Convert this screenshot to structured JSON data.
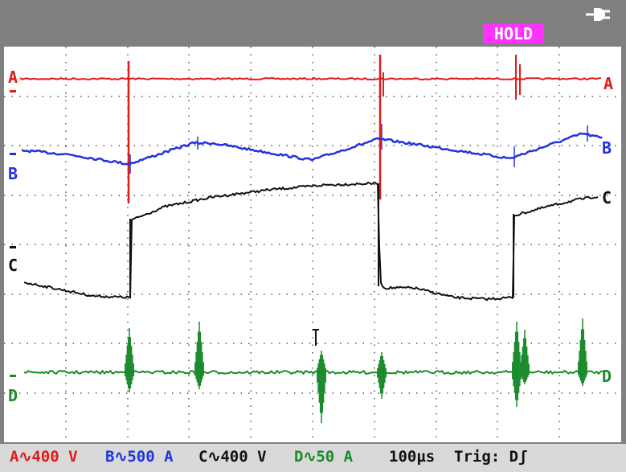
{
  "status": {
    "hold": "HOLD"
  },
  "icons": {
    "power": "power-plug-icon"
  },
  "channels": [
    {
      "id": "A",
      "label": "A",
      "color": "#e21b1b"
    },
    {
      "id": "B",
      "label": "B",
      "color": "#2233dd"
    },
    {
      "id": "C",
      "label": "C",
      "color": "#111111"
    },
    {
      "id": "D",
      "label": "D",
      "color": "#1b8a2a"
    }
  ],
  "readouts": {
    "a": "A∿400 V",
    "b": "B∿500 A",
    "c": "C∿400 V",
    "d": "D∿50 A",
    "timebase": "100µs",
    "trigger": "Trig: Dʃ"
  },
  "colors": {
    "a": "#e21b1b",
    "b": "#2233dd",
    "c": "#111111",
    "d": "#1b8a2a",
    "hold": "#ff33ff",
    "frame": "#808080",
    "grid": "#555555"
  }
}
